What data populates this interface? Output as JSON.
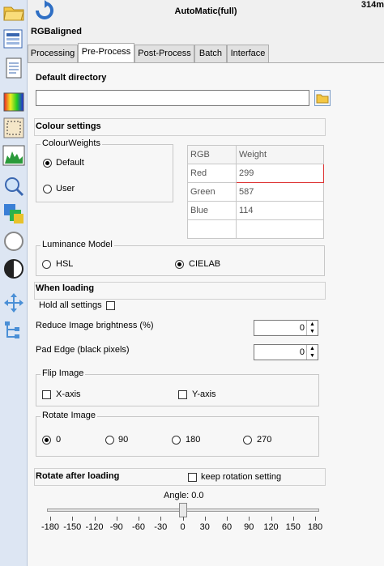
{
  "window": {
    "title": "AutoMatic(full)",
    "title_right": "314m",
    "subtitle": "RGBaligned"
  },
  "toolbar": {
    "icons": [
      "folder-open-icon",
      "refresh-icon",
      "image-stack-icon",
      "document-icon",
      "color-gradient-icon",
      "select-rectangle-icon",
      "histogram-icon",
      "zoom-icon",
      "color-layers-icon",
      "circle-icon",
      "contrast-icon",
      "move-arrows-icon",
      "tree-icon"
    ]
  },
  "tabs": [
    {
      "label": "Processing",
      "active": false
    },
    {
      "label": "Pre-Process",
      "active": true
    },
    {
      "label": "Post-Process",
      "active": false
    },
    {
      "label": "Batch",
      "active": false
    },
    {
      "label": "Interface",
      "active": false
    }
  ],
  "default_directory": {
    "heading": "Default directory",
    "value": ""
  },
  "colour_settings": {
    "heading": "Colour settings",
    "colour_weights": {
      "label": "ColourWeights",
      "options": [
        "Default",
        "User"
      ],
      "selected": "Default"
    },
    "table": {
      "headers": [
        "RGB",
        "Weight"
      ],
      "rows": [
        {
          "channel": "Red",
          "weight": "299"
        },
        {
          "channel": "Green",
          "weight": "587"
        },
        {
          "channel": "Blue",
          "weight": "114"
        }
      ]
    },
    "luminance_model": {
      "label": "Luminance Model",
      "options": [
        "HSL",
        "CIELAB"
      ],
      "selected": "CIELAB"
    }
  },
  "when_loading": {
    "heading": "When loading",
    "hold_all_settings": "Hold all settings",
    "reduce_brightness_label": "Reduce Image brightness (%)",
    "reduce_brightness_value": "0",
    "pad_edge_label": "Pad Edge (black pixels)",
    "pad_edge_value": "0",
    "flip_image": {
      "label": "Flip Image",
      "x_axis": "X-axis",
      "y_axis": "Y-axis"
    },
    "rotate_image": {
      "label": "Rotate Image",
      "options": [
        "0",
        "90",
        "180",
        "270"
      ],
      "selected": "0"
    }
  },
  "rotate_after_loading": {
    "heading": "Rotate after loading",
    "keep_rotation": "keep rotation setting",
    "angle_label": "Angle: 0.0",
    "angle_value": 0,
    "range": [
      -180,
      180
    ],
    "tick_labels": [
      "-180",
      "-150",
      "-120",
      "-90",
      "-60",
      "-30",
      "0",
      "30",
      "60",
      "90",
      "120",
      "150",
      "180"
    ]
  }
}
